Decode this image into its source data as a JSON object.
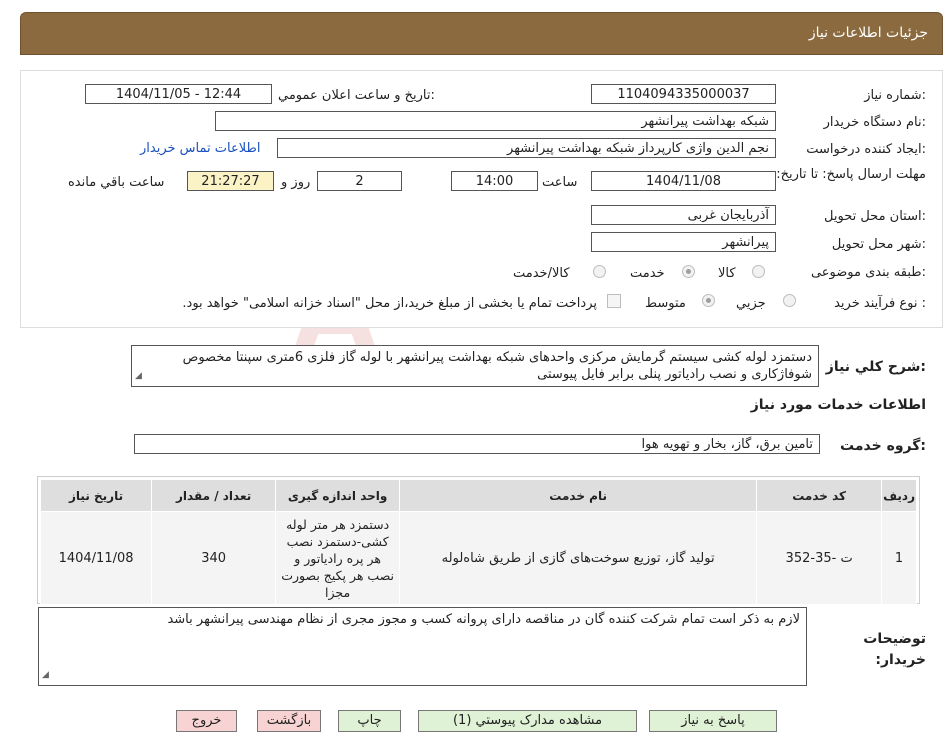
{
  "header": {
    "title": "جزئیات اطلاعات نیاز"
  },
  "fields": {
    "need_number_label": "شماره نیاز:",
    "need_number": "1104094335000037",
    "announce_label": "تاریخ و ساعت اعلان عمومي:",
    "announce_value": "1404/11/05 - 12:44",
    "buyer_org_label": "نام دستگاه خريدار:",
    "buyer_org": "شبکه بهداشت پیرانشهر",
    "requester_label": "ایجاد کننده درخواست:",
    "requester": "نجم الدين واژی کارپرداز شبکه بهداشت پیرانشهر",
    "contact_link": "اطلاعات تماس خریدار",
    "deadline_label": "مهلت ارسال پاسخ: تا تاریخ:",
    "deadline_date": "1404/11/08",
    "time_label": "ساعت",
    "deadline_time": "14:00",
    "days_value": "2",
    "days_label": "روز و",
    "remaining_time": "21:27:27",
    "remaining_label": "ساعت باقي مانده",
    "province_label": "استان محل تحویل:",
    "province": "آذربایجان غربی",
    "city_label": "شهر محل تحویل:",
    "city": "پیرانشهر",
    "category_label": "طبقه بندی موضوعی:",
    "category_options": [
      "کالا",
      "خدمت",
      "کالا/خدمت"
    ],
    "category_selected": "خدمت",
    "process_label": "نوع فرآیند خرید :",
    "process_options": [
      "جزيي",
      "متوسط"
    ],
    "process_selected": "متوسط",
    "payment_note": "پرداخت تمام یا بخشی از مبلغ خرید،از محل \"اسناد خزانه اسلامی\" خواهد بود."
  },
  "description": {
    "label": "شرح کلي نياز:",
    "text": "دستمزد لوله کشی سیستم گرمایش مرکزی واحدهای شبکه بهداشت پیرانشهر با لوله گاز فلزی 6متری سپنتا مخصوص شوفاژکاری و نصب رادیاتور پنلی برابر فایل پیوستی"
  },
  "services": {
    "section_title": "اطلاعات خدمات مورد نياز",
    "group_label": "گروه خدمت:",
    "group_value": "تامین برق، گاز، بخار و تهویه هوا",
    "columns": [
      "رديف",
      "کد خدمت",
      "نام خدمت",
      "واحد اندازه گیری",
      "تعداد / مقدار",
      "تاریخ نیاز"
    ],
    "rows": [
      {
        "row": "1",
        "code": "ت -35-352",
        "name": "تولید گاز، توزیع سوخت‌های گازی از طریق شاه‌لوله",
        "unit": "دستمزد هر متر لوله کشی-دستمزد نصب هر پره رادیاتور و نصب هر پکیج بصورت مجزا",
        "quantity": "340",
        "date": "1404/11/08"
      }
    ]
  },
  "buyer_notes": {
    "label": "توضیحات خریدار:",
    "text": "لازم به ذکر است تمام شرکت کننده گان در مناقصه دارای پروانه کسب و مجوز مجری از نظام مهندسی پیرانشهر باشد"
  },
  "buttons": {
    "reply": "پاسخ به نياز",
    "view_docs": "مشاهده مدارک پیوستي (1)",
    "print": "چاپ",
    "back": "بازگشت",
    "exit": "خروج"
  },
  "watermark": {
    "text": "AriaTender.neT"
  },
  "colors": {
    "header_bg": "#8b6a3f",
    "green_btn": "#dff2d6",
    "pink_btn": "#f8d3d3",
    "yellow_box": "#fbf3c6",
    "link": "#1a4fbf"
  }
}
